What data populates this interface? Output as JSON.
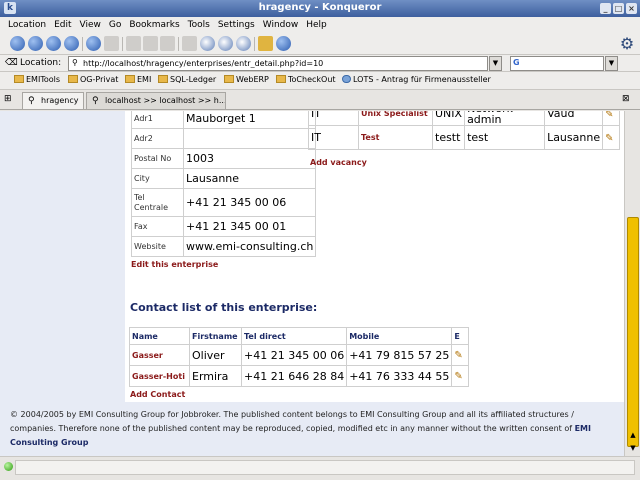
{
  "window": {
    "title": "hragency - Konqueror"
  },
  "menu": [
    "Location",
    "Edit",
    "View",
    "Go",
    "Bookmarks",
    "Tools",
    "Settings",
    "Window",
    "Help"
  ],
  "location": {
    "label": "Location:",
    "url": "http://localhost/hragency/enterprises/entr_detail.php?id=10",
    "search_value": "",
    "search_engine_icon": "G"
  },
  "bookmarks": [
    "EMITools",
    "OG-Privat",
    "EMI",
    "SQL-Ledger",
    "WebERP",
    "ToCheckOut",
    "LOTS - Antrag für Firmenaussteller"
  ],
  "tabs": [
    {
      "label": "hragency"
    },
    {
      "label": "localhost >> localhost >> h..."
    }
  ],
  "enterprise": {
    "rows": [
      {
        "label": "Adr1",
        "value": "Mauborget 1"
      },
      {
        "label": "Adr2",
        "value": ""
      },
      {
        "label": "Postal No",
        "value": "1003"
      },
      {
        "label": "City",
        "value": "Lausanne"
      },
      {
        "label": "Tel Centrale",
        "value": "+41 21 345 00 06"
      },
      {
        "label": "Fax",
        "value": "+41 21 345 00 01"
      },
      {
        "label": "Website",
        "value": "www.emi-consulting.ch"
      }
    ],
    "edit_link": "Edit this enterprise"
  },
  "vacancies": {
    "rows": [
      {
        "area": "IT",
        "title": "Unix Specialist",
        "skill": "UNIX",
        "detail": "Network admin",
        "canton": "Vaud"
      },
      {
        "area": "IT",
        "title": "Test",
        "skill": "testt",
        "detail": "test",
        "canton": "Lausanne"
      }
    ],
    "add_link": "Add vacancy"
  },
  "contacts": {
    "title": "Contact list of this enterprise:",
    "headers": [
      "Name",
      "Firstname",
      "Tel direct",
      "Mobile",
      "E"
    ],
    "rows": [
      {
        "name": "Gasser",
        "firstname": "Oliver",
        "tel": "+41 21 345 00 06",
        "mobile": "+41 79 815 57 25"
      },
      {
        "name": "Gasser-Hoti",
        "firstname": "Ermira",
        "tel": "+41 21 646 28 84",
        "mobile": "+41 76 333 44 55"
      }
    ],
    "add_link": "Add Contact"
  },
  "footer": {
    "text": "© 2004/2005 by EMI Consulting Group for Jobbroker. The published content belongs to EMI Consulting Group and all its affiliated structures / companies. Therefore none of the published content may be reproduced, copied, modified etc in any manner without the written consent of ",
    "bold": "EMI Consulting Group"
  },
  "status": {
    "text": ""
  }
}
